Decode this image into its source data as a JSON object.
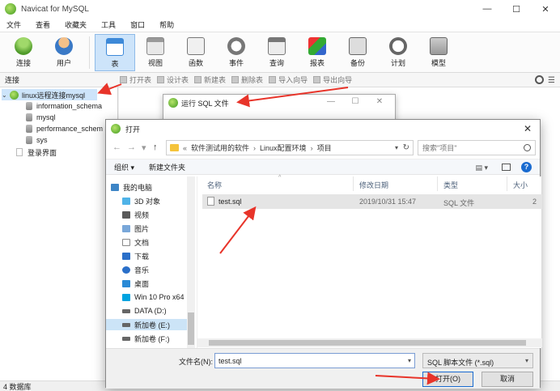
{
  "app": {
    "title": "Navicat for MySQL"
  },
  "window_controls": {
    "minimize": "—",
    "maximize": "☐",
    "close": "✕"
  },
  "menu": [
    "文件",
    "查看",
    "收藏夹",
    "工具",
    "窗口",
    "帮助"
  ],
  "toolbar": {
    "items": [
      {
        "label": "连接",
        "icon": "connection-icon"
      },
      {
        "label": "用户",
        "icon": "user-icon"
      },
      {
        "label": "表",
        "icon": "table-icon",
        "active": true
      },
      {
        "label": "视图",
        "icon": "view-icon"
      },
      {
        "label": "函数",
        "icon": "function-icon"
      },
      {
        "label": "事件",
        "icon": "event-icon"
      },
      {
        "label": "查询",
        "icon": "query-icon"
      },
      {
        "label": "报表",
        "icon": "report-icon"
      },
      {
        "label": "备份",
        "icon": "backup-icon"
      },
      {
        "label": "计划",
        "icon": "schedule-icon"
      },
      {
        "label": "模型",
        "icon": "model-icon"
      }
    ]
  },
  "subbar": {
    "connection_label": "连接",
    "actions": [
      "打开表",
      "设计表",
      "新建表",
      "删除表",
      "导入向导",
      "导出向导"
    ]
  },
  "sidebar": {
    "connection": "linux远程连接mysql",
    "databases": [
      "information_schema",
      "mysql",
      "performance_schem",
      "sys"
    ],
    "other": "登录界面"
  },
  "status": {
    "text": "4 数据库"
  },
  "run_sql_dialog": {
    "title": "运行 SQL 文件"
  },
  "open_dialog": {
    "title": "打开",
    "nav": {
      "back": "←",
      "forward": "→",
      "up": "↑",
      "dd": "▾"
    },
    "breadcrumb": [
      "«",
      "软件测试用的软件",
      "›",
      "Linux配置环境",
      "›",
      "项目"
    ],
    "search_placeholder": "搜索\"项目\"",
    "organize": "组织 ▾",
    "new_folder": "新建文件夹",
    "view_icon": "▤ ▾",
    "help": "?",
    "nav_pane": [
      {
        "label": "我的电脑",
        "icon": "pc"
      },
      {
        "label": "3D 对象",
        "icon": "cube"
      },
      {
        "label": "视频",
        "icon": "video"
      },
      {
        "label": "图片",
        "icon": "pic"
      },
      {
        "label": "文档",
        "icon": "doc"
      },
      {
        "label": "下载",
        "icon": "down"
      },
      {
        "label": "音乐",
        "icon": "music"
      },
      {
        "label": "桌面",
        "icon": "desk"
      },
      {
        "label": "Win 10 Pro x64",
        "icon": "win"
      },
      {
        "label": "DATA (D:)",
        "icon": "drive"
      },
      {
        "label": "新加卷 (E:)",
        "icon": "drive",
        "selected": true
      },
      {
        "label": "新加卷 (F:)",
        "icon": "drive"
      }
    ],
    "columns": [
      "名称",
      "修改日期",
      "类型",
      "大小"
    ],
    "sort_indicator": "^",
    "files": [
      {
        "name": "test.sql",
        "modified": "2019/10/31 15:47",
        "type": "SQL 文件",
        "size": "2"
      }
    ],
    "filename_label": "文件名(N):",
    "filename_value": "test.sql",
    "filetype": "SQL 脚本文件 (*.sql)",
    "open_button": "打开(O)",
    "cancel_button": "取消"
  },
  "annotation_color": "#e8342a"
}
